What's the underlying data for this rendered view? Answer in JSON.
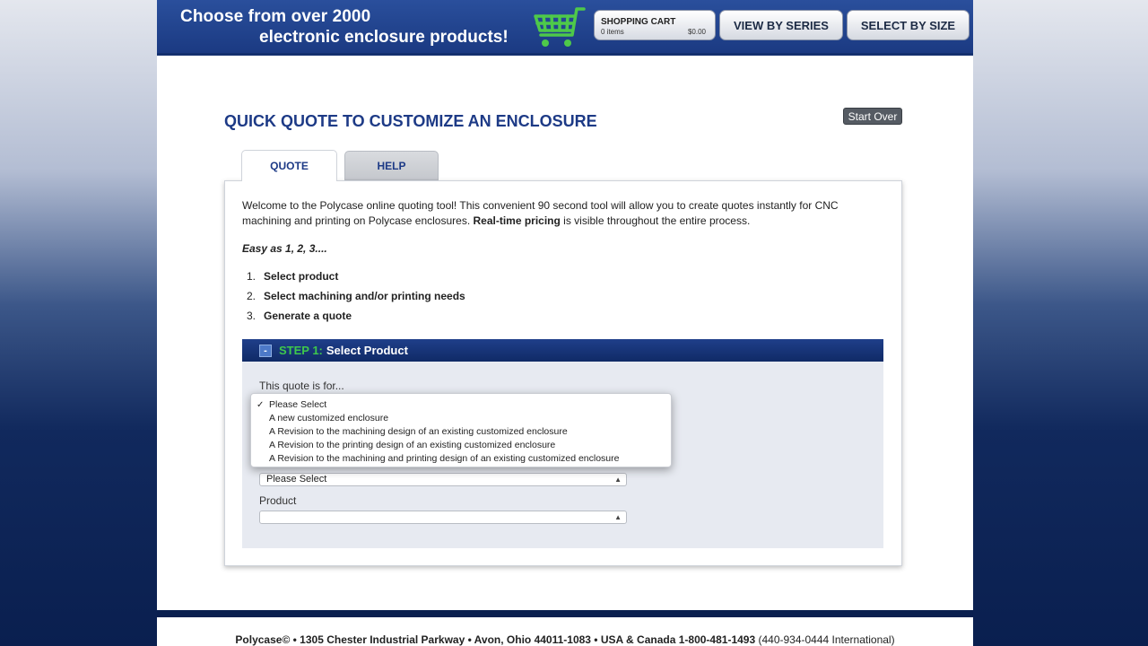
{
  "header": {
    "tagline_line1": "Choose from over 2000",
    "tagline_line2": "electronic enclosure products!",
    "cart": {
      "title": "SHOPPING CART",
      "items": "0 items",
      "total": "$0.00"
    },
    "nav": {
      "series": "VIEW BY SERIES",
      "size": "SELECT BY SIZE"
    },
    "colors": {
      "header_bg": "#1b3a82",
      "cart_icon": "#4ec94a"
    }
  },
  "main": {
    "title": "QUICK QUOTE TO CUSTOMIZE AN ENCLOSURE",
    "start_over": "Start Over",
    "tabs": [
      {
        "label": "QUOTE"
      },
      {
        "label": "HELP"
      }
    ],
    "intro_part1": "Welcome to the Polycase online quoting tool! This convenient 90 second tool will allow you to create quotes instantly for CNC machining and printing on Polycase enclosures. ",
    "intro_bold": "Real-time pricing",
    "intro_part2": " is visible throughout the entire process.",
    "easy": "Easy as 1, 2, 3....",
    "steps": [
      {
        "num": "1.",
        "text": "Select product"
      },
      {
        "num": "2.",
        "text": "Select machining and/or printing needs"
      },
      {
        "num": "3.",
        "text": "Generate a quote"
      }
    ],
    "step1": {
      "icon": "collapse-icon",
      "collapse_glyph": "-",
      "label": "STEP 1:",
      "title": "Select Product",
      "quote_for_label": "This quote is for...",
      "dropdown_options": [
        {
          "check": "✓",
          "text": "Please Select"
        },
        {
          "check": "",
          "text": "A new customized enclosure"
        },
        {
          "check": "",
          "text": "A Revision to the machining design of an existing customized enclosure"
        },
        {
          "check": "",
          "text": "A Revision to the printing design of an existing customized enclosure"
        },
        {
          "check": "",
          "text": "A Revision to the machining and printing design of an existing customized enclosure"
        }
      ],
      "second_select_value": "Please Select",
      "product_label": "Product",
      "product_select_value": ""
    }
  },
  "footer": {
    "company": "Polycase©",
    "address": " • 1305 Chester Industrial Parkway • Avon, Ohio 44011-1083 • USA & Canada 1-800-481-1493",
    "intl": " (440-934-0444 International)"
  }
}
